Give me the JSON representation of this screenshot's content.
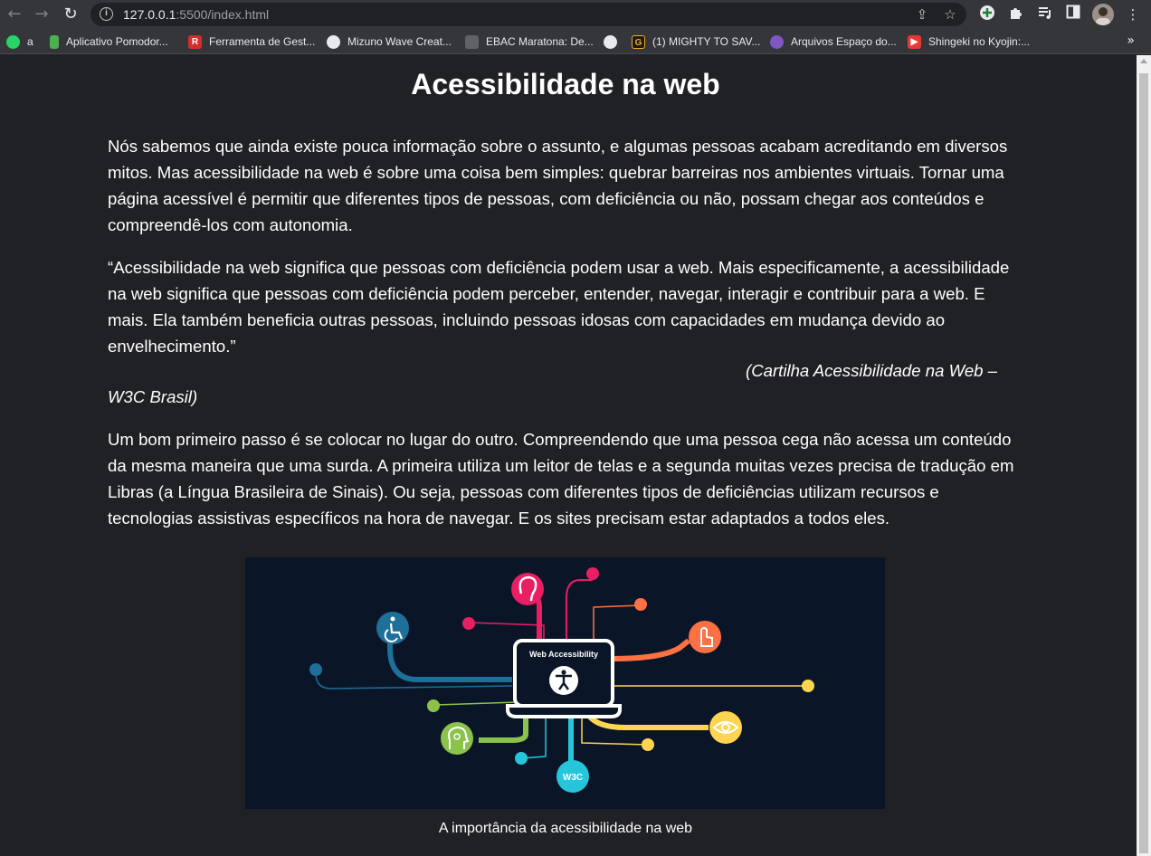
{
  "browser": {
    "url_host": "127.0.0.1",
    "url_rest": ":5500/index.html",
    "bookmarks": [
      {
        "label": "a",
        "color": "#25d366"
      },
      {
        "label": "Aplicativo Pomodor...",
        "color": "#4caf50"
      },
      {
        "label": "Ferramenta de Gest...",
        "color": "#d32f2f"
      },
      {
        "label": "Mizuno Wave Creat...",
        "color": "#e8eaed"
      },
      {
        "label": "EBAC Maratona: De...",
        "color": "#9e9e9e"
      },
      {
        "label": "",
        "color": "#e8eaed"
      },
      {
        "label": "(1) MIGHTY TO SAV...",
        "color": "#f9a825"
      },
      {
        "label": "Arquivos Espaço do...",
        "color": "#7e57c2"
      },
      {
        "label": "Shingeki no Kyojin:...",
        "color": "#e53935"
      }
    ]
  },
  "page": {
    "title": "Acessibilidade na web",
    "paragraph1": "Nós sabemos que ainda existe pouca informação sobre o assunto, e algumas pessoas acabam acreditando em diversos mitos. Mas acessibilidade na web é sobre uma coisa bem simples: quebrar barreiras nos ambientes virtuais. Tornar uma página acessível é permitir que diferentes tipos de pessoas, com deficiência ou não, possam chegar aos conteúdos e compreendê-los com autonomia.",
    "quote": "“Acessibilidade na web significa que pessoas com deficiência podem usar a web. Mais especificamente, a acessibilidade na web significa que pessoas com deficiência podem perceber, entender, navegar, interagir e contribuir para a web. E mais. Ela também beneficia outras pessoas, incluindo pessoas idosas com capacidades em mudança devido ao envelhecimento.”",
    "citation": "(Cartilha Acessibilidade na Web – W3C Brasil)",
    "paragraph2": "Um bom primeiro passo é se colocar no lugar do outro. Compreendendo que uma pessoa cega não acessa um conteúdo da mesma maneira que uma surda. A primeira utiliza um leitor de telas e a segunda muitas vezes precisa de tradução em Libras (a Língua Brasileira de Sinais). Ou seja, pessoas com diferentes tipos de deficiências utilizam recursos e tecnologias assistivas específicos na hora de navegar. E os sites precisam estar adaptados a todos eles.",
    "figure_label": "Web Accessibility",
    "figure_badge": "W3C",
    "caption": "A importância da acessibilidade na web"
  }
}
